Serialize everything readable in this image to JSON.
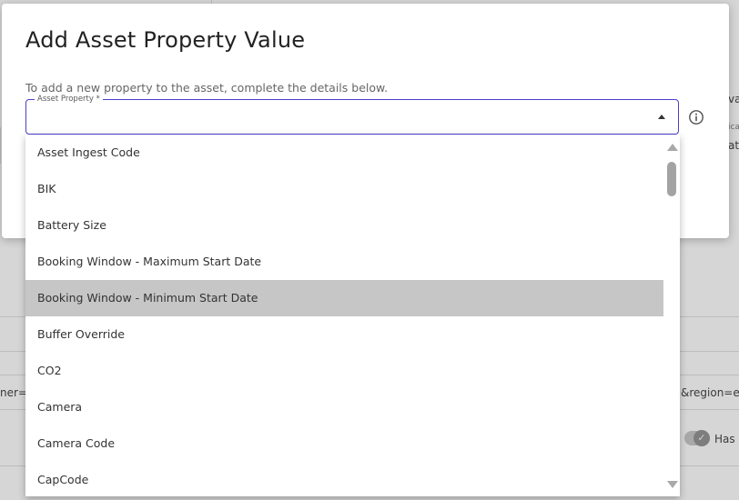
{
  "modal": {
    "title": "Add Asset Property Value",
    "description": "To add a new property to the asset, complete the details below.",
    "field_label": "Asset Property *",
    "field_value": ""
  },
  "dropdown": {
    "options": [
      "Asset Ingest Code",
      "BIK",
      "Battery Size",
      "Booking Window - Maximum Start Date",
      "Booking Window - Minimum Start Date",
      "Buffer Override",
      "CO2",
      "Camera",
      "Camera Code",
      "CapCode"
    ],
    "highlighted_index": 4
  },
  "background": {
    "url_fragment_left": "ner=t",
    "url_fragment_right": "&region=eu",
    "toggle_label": "Has",
    "right_text_1": "va",
    "right_text_2": "ica",
    "right_text_3": "at"
  },
  "colors": {
    "accent": "#4b3fcf",
    "button": "#6b6be0",
    "highlight": "#c6c6c6"
  },
  "icons": {
    "info": "info-circle-icon",
    "caret": "caret-up-icon"
  }
}
